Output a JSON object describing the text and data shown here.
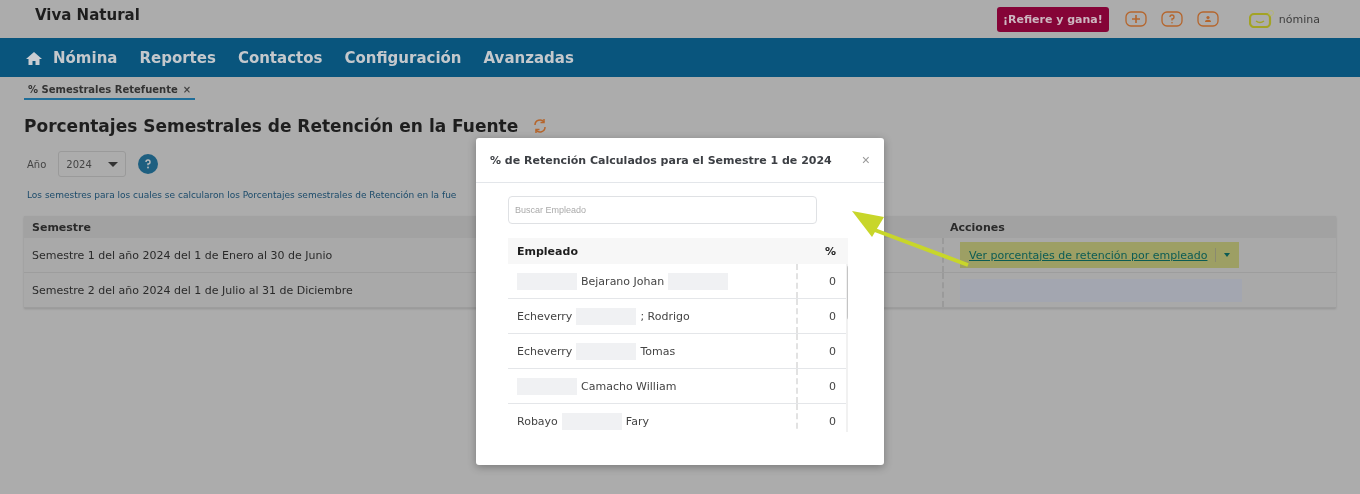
{
  "header": {
    "company": "Viva Natural",
    "refer_button": "¡Refiere y gana!",
    "product": "nómina"
  },
  "nav": {
    "items": [
      {
        "label": "Nómina",
        "selected": false
      },
      {
        "label": "Reportes",
        "selected": false
      },
      {
        "label": "Contactos",
        "selected": false
      },
      {
        "label": "Configuración",
        "selected": false
      },
      {
        "label": "Avanzadas",
        "selected": false
      }
    ]
  },
  "open_tabs": [
    {
      "label": "% Semestrales Retefuente",
      "close": "×",
      "selected": true
    }
  ],
  "page": {
    "title": "Porcentajes Semestrales de Retención en la Fuente",
    "year_label": "Año",
    "year_value": "2024",
    "note": "Los semestres para los cuales se calcularon los Porcentajes semestrales de Retención en la fue",
    "table": {
      "columns": [
        "Semestre",
        "Acciones"
      ],
      "rows": [
        {
          "semestre": "Semestre 1 del año 2024 del 1 de Enero al 30 de Junio",
          "action": {
            "kind": "link",
            "label": "Ver porcentajes de retención por empleado",
            "highlighted": true
          }
        },
        {
          "semestre": "Semestre 2 del año 2024 del 1 de Julio al 31 de Diciembre",
          "action": {
            "kind": "blur"
          }
        }
      ]
    }
  },
  "modal": {
    "title": "% de Retención Calculados para el Semestre 1 de 2024",
    "close": "×",
    "search": {
      "placeholder": "Buscar Empleado"
    },
    "columns": [
      "Empleado",
      "%"
    ],
    "rows": [
      {
        "segments": [
          {
            "kind": "blur"
          },
          {
            "kind": "text",
            "text": "Bejarano Johan"
          },
          {
            "kind": "blur"
          }
        ],
        "percent": "0"
      },
      {
        "segments": [
          {
            "kind": "text",
            "text": "Echeverry"
          },
          {
            "kind": "blur"
          },
          {
            "kind": "text",
            "text": "; Rodrigo"
          }
        ],
        "percent": "0"
      },
      {
        "segments": [
          {
            "kind": "text",
            "text": "Echeverry"
          },
          {
            "kind": "blur"
          },
          {
            "kind": "text",
            "text": "Tomas"
          }
        ],
        "percent": "0"
      },
      {
        "segments": [
          {
            "kind": "blur"
          },
          {
            "kind": "text",
            "text": "Camacho William"
          }
        ],
        "percent": "0"
      },
      {
        "segments": [
          {
            "kind": "text",
            "text": "Robayo"
          },
          {
            "kind": "blur"
          },
          {
            "kind": "text",
            "text": "Fary"
          }
        ],
        "percent": "0"
      }
    ]
  }
}
